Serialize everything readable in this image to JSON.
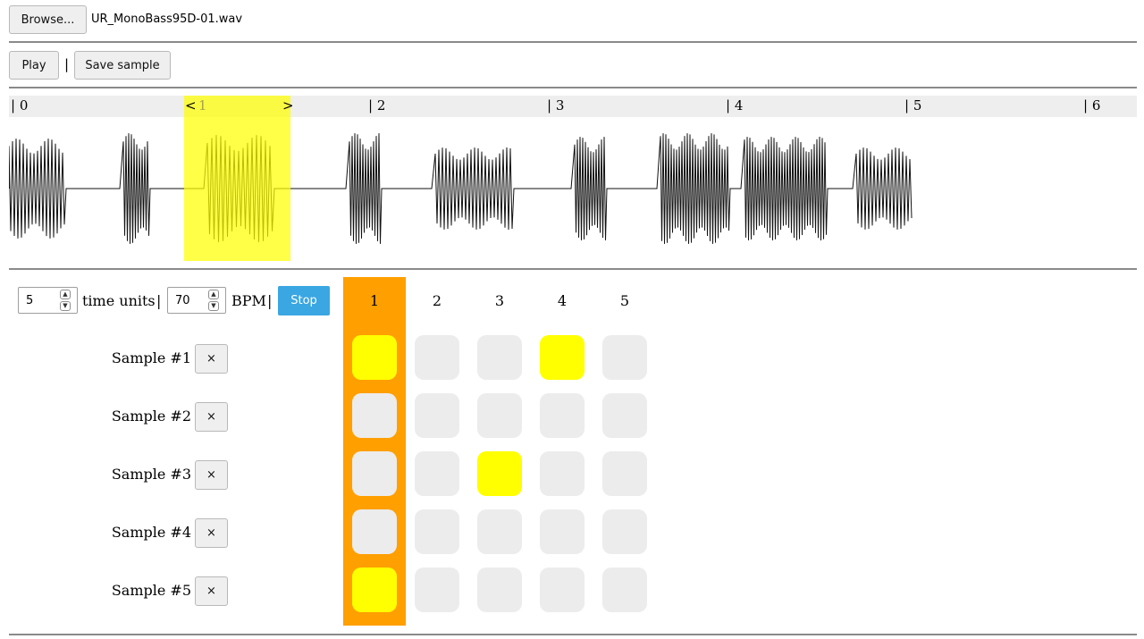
{
  "file": {
    "browse_label": "Browse...",
    "filename": "UR_MonoBass95D-01.wav"
  },
  "controls": {
    "play_label": "Play",
    "separator": "|",
    "save_label": "Save sample"
  },
  "ruler": {
    "ticks": [
      "| 0",
      "| 2",
      "| 3",
      "| 4",
      "| 5",
      "| 6"
    ],
    "selection_left": "<",
    "selection_num": "1",
    "selection_right": ">"
  },
  "sequencer": {
    "time_units_value": "5",
    "time_units_label": "time units",
    "sep": "|",
    "bpm_value": "70",
    "bpm_label": "BPM",
    "stop_label": "Stop",
    "columns": [
      "1",
      "2",
      "3",
      "4",
      "5"
    ],
    "active_column": 1,
    "remove_label": "×",
    "rows": [
      {
        "label": "Sample #1",
        "cells": [
          true,
          false,
          false,
          true,
          false
        ]
      },
      {
        "label": "Sample #2",
        "cells": [
          false,
          false,
          false,
          false,
          false
        ]
      },
      {
        "label": "Sample #3",
        "cells": [
          false,
          false,
          true,
          false,
          false
        ]
      },
      {
        "label": "Sample #4",
        "cells": [
          false,
          false,
          false,
          false,
          false
        ]
      },
      {
        "label": "Sample #5",
        "cells": [
          true,
          false,
          false,
          false,
          false
        ]
      }
    ]
  },
  "colors": {
    "accent": "#3aa6e2",
    "active_column": "#ff9f00",
    "on_cell": "#ffff00",
    "off_cell": "#ececec"
  }
}
